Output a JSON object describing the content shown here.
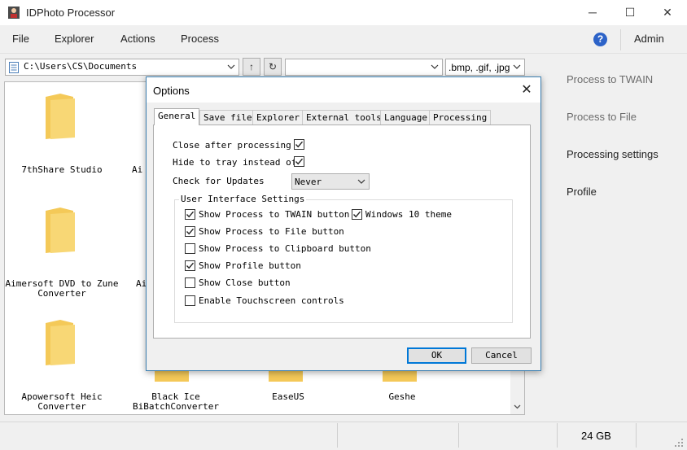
{
  "window": {
    "title": "IDPhoto Processor",
    "min_glyph": "─",
    "max_glyph": "☐",
    "close_glyph": "✕"
  },
  "menu": {
    "items": [
      "File",
      "Explorer",
      "Actions",
      "Process"
    ],
    "help_glyph": "?",
    "admin": "Admin"
  },
  "toolbar": {
    "path": "C:\\Users\\CS\\Documents",
    "up_glyph": "↑",
    "refresh_glyph": "↻",
    "filter_value": "",
    "extensions": ".bmp, .gif, .jpg"
  },
  "files": [
    "7thShare Studio",
    "Ai",
    "Aimersoft DVD to Zune Converter",
    "Ai",
    "Apowersoft Heic Converter",
    "Black Ice BiBatchConverter",
    "EaseUS",
    "Geshe"
  ],
  "right_pane": {
    "process_twain": "Process to TWAIN",
    "process_file": "Process to File",
    "processing_settings": "Processing settings",
    "profile": "Profile"
  },
  "status_bar": {
    "disk": "24 GB"
  },
  "dialog": {
    "title": "Options",
    "close_glyph": "✕",
    "tabs": [
      "General",
      "Save file",
      "Explorer",
      "External tools",
      "Language",
      "Processing"
    ],
    "active_tab": "General",
    "general": {
      "close_after_processing": {
        "label": "Close after processing",
        "checked": true
      },
      "hide_to_tray": {
        "label": "Hide to tray instead of",
        "checked": true
      },
      "check_updates": {
        "label": "Check for Updates",
        "value": "Never"
      },
      "ui_group": {
        "title": "User Interface Settings",
        "options": [
          {
            "label": "Show Process to TWAIN button",
            "checked": true
          },
          {
            "label": "Show Process to File button",
            "checked": true
          },
          {
            "label": "Show Process to Clipboard button",
            "checked": false
          },
          {
            "label": "Show Profile button",
            "checked": true
          },
          {
            "label": "Show Close button",
            "checked": false
          },
          {
            "label": "Enable Touchscreen controls",
            "checked": false
          }
        ],
        "windows10": {
          "label": "Windows 10 theme",
          "checked": true
        }
      }
    },
    "ok": "OK",
    "cancel": "Cancel"
  },
  "colors": {
    "accent": "#0078d7",
    "folder": "#f8d775",
    "help": "#2d63c8"
  }
}
